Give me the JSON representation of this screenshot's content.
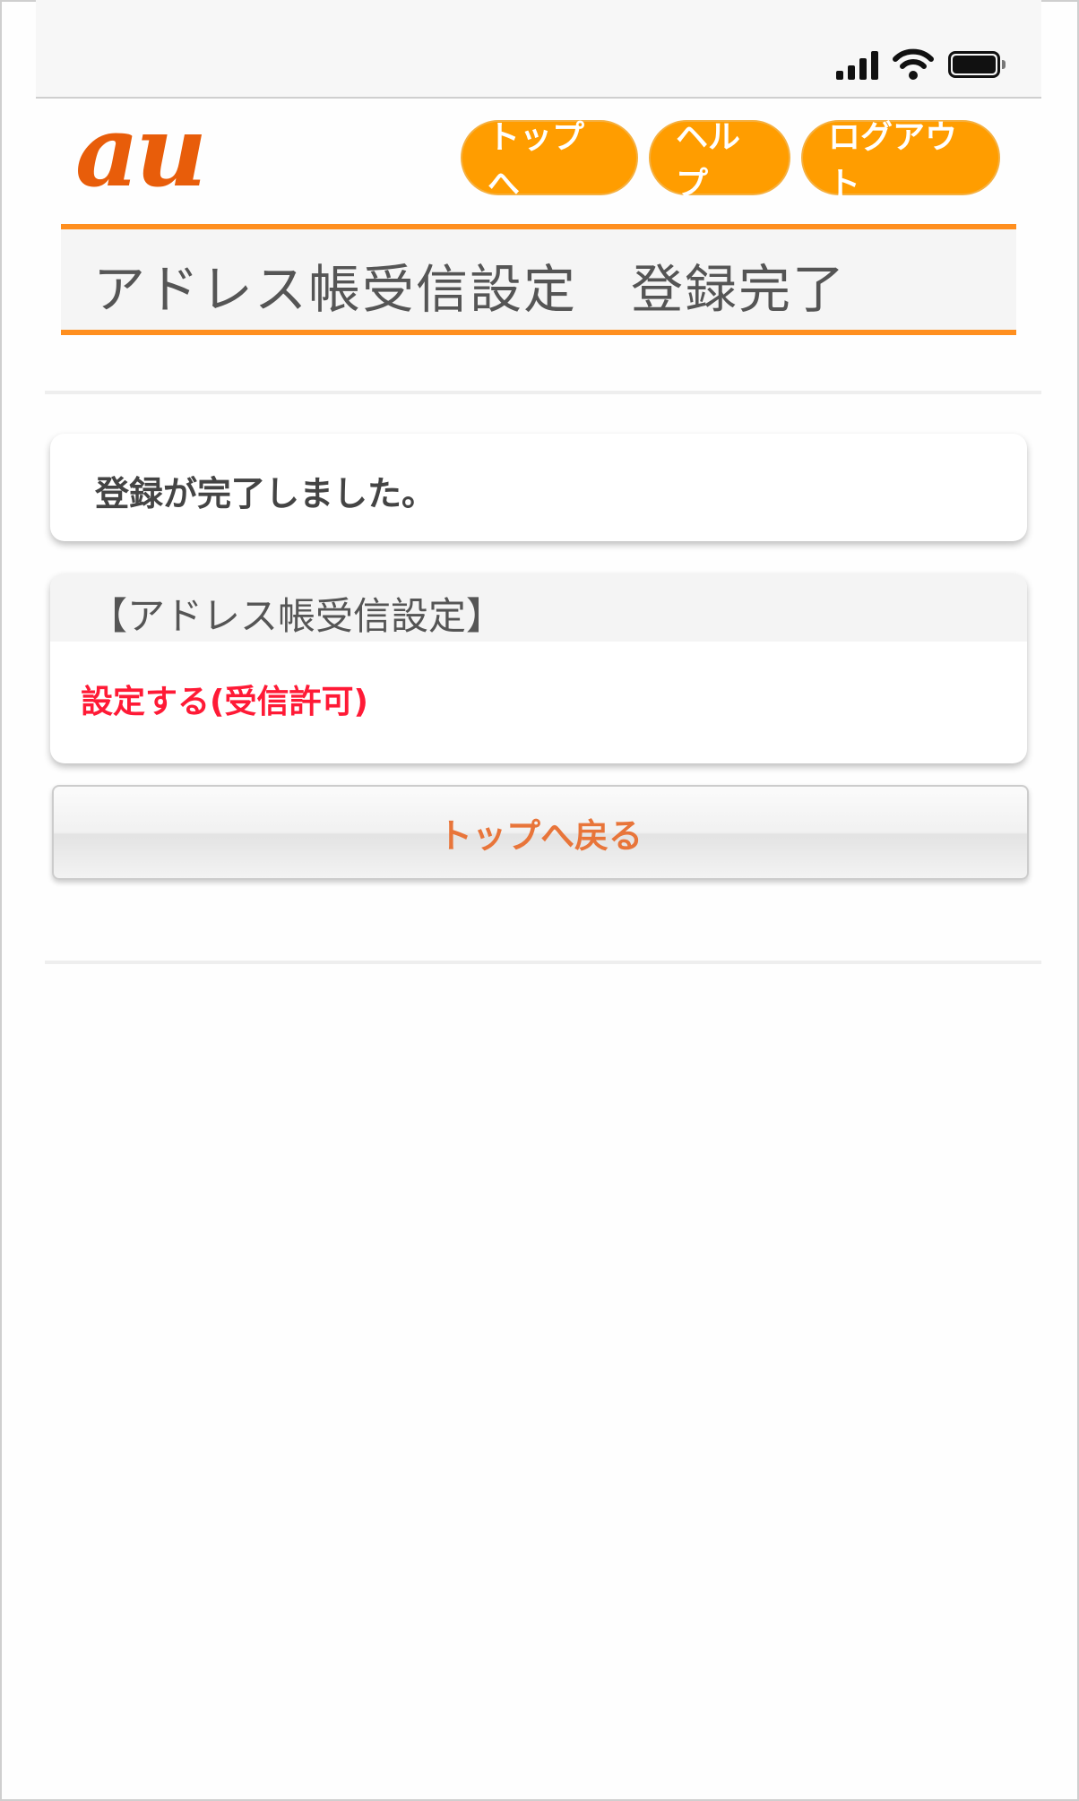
{
  "status_bar": {
    "icons": [
      "signal-icon",
      "wifi-icon",
      "battery-icon"
    ]
  },
  "header": {
    "logo_text": "au",
    "nav": {
      "top": "トップへ",
      "help": "ヘルプ",
      "logout": "ログアウト"
    }
  },
  "page_title": "アドレス帳受信設定　登録完了",
  "message": "登録が完了しました。",
  "setting": {
    "heading": "【アドレス帳受信設定】",
    "value": "設定する(受信許可)"
  },
  "back_button": "トップへ戻る",
  "colors": {
    "brand": "#e85d0a",
    "nav_button": "#ff9d00",
    "title_rule": "#ff8f1f",
    "setting_value": "#ff1a36",
    "back_label": "#e8753a"
  }
}
